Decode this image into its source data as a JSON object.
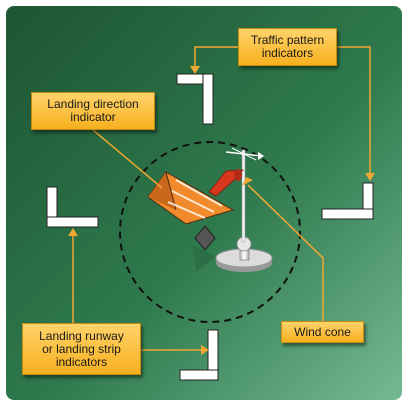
{
  "callouts": {
    "traffic_pattern": "Traffic pattern\nindicators",
    "landing_direction": "Landing direction\nindicator",
    "landing_runway": "Landing runway\nor landing strip\nindicators",
    "wind_cone": "Wind cone"
  },
  "colors": {
    "panel_dark": "#1f5a36",
    "panel_light": "#6fb58c",
    "callout": "#f6b01e",
    "leader_line": "#f0a832",
    "tetrahedron": "#f08a2a",
    "windsock": "#d9361e",
    "marker": "#ffffff"
  },
  "icons": [
    "l-shaped-marker",
    "tetrahedron",
    "wind-cone",
    "segmented-circle"
  ]
}
